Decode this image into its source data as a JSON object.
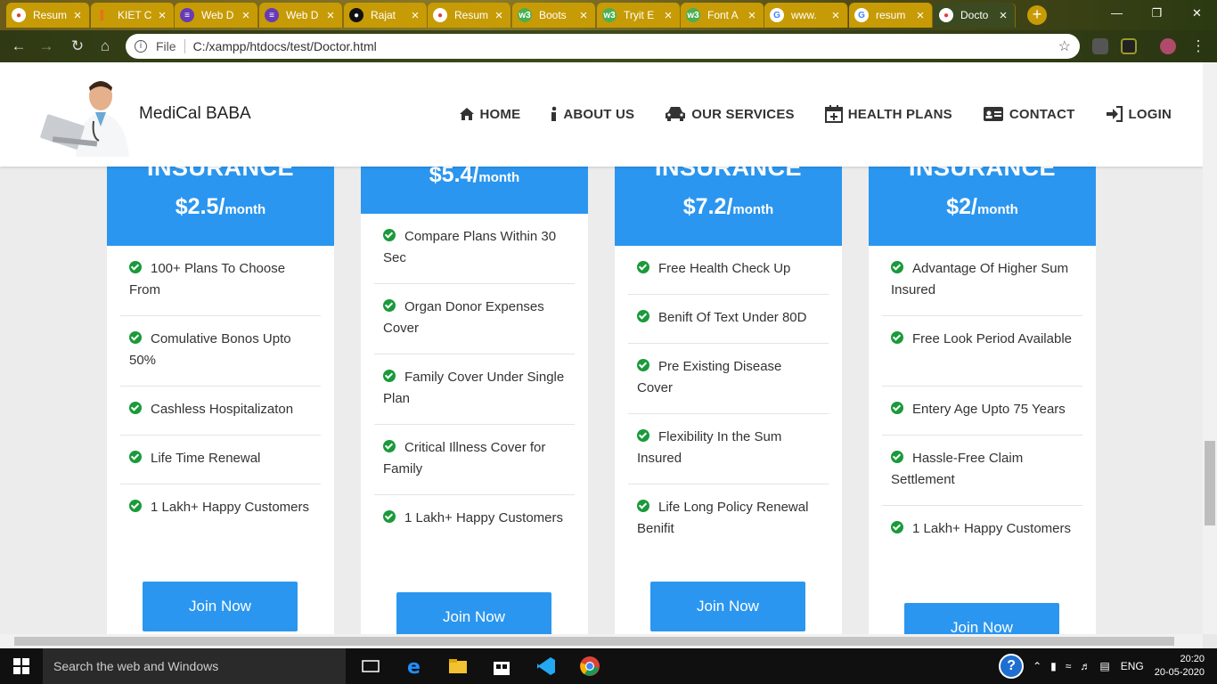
{
  "browser": {
    "tabs": [
      {
        "label": "Resum",
        "icon": "chrome-icon"
      },
      {
        "label": "KIET C",
        "icon": "chart-icon"
      },
      {
        "label": "Web D",
        "icon": "form-icon"
      },
      {
        "label": "Web D",
        "icon": "form-icon"
      },
      {
        "label": "Rajat",
        "icon": "github-icon"
      },
      {
        "label": "Resum",
        "icon": "chrome-icon"
      },
      {
        "label": "Boots",
        "icon": "w3-icon"
      },
      {
        "label": "Tryit E",
        "icon": "w3-icon"
      },
      {
        "label": "Font A",
        "icon": "w3-icon"
      },
      {
        "label": "www.",
        "icon": "google-icon"
      },
      {
        "label": "resum",
        "icon": "google-icon"
      },
      {
        "label": "Docto",
        "icon": "chrome-icon"
      }
    ],
    "address": {
      "scheme_label": "File",
      "url": "C:/xampp/htdocs/test/Doctor.html"
    }
  },
  "site": {
    "brand": "MediCal BABA",
    "nav": [
      {
        "label": "HOME",
        "icon": "home-icon"
      },
      {
        "label": "ABOUT US",
        "icon": "info-icon"
      },
      {
        "label": "OUR SERVICES",
        "icon": "car-icon"
      },
      {
        "label": "HEALTH PLANS",
        "icon": "calendar-plus-icon"
      },
      {
        "label": "CONTACT",
        "icon": "id-card-icon"
      },
      {
        "label": "LOGIN",
        "icon": "sign-in-icon"
      }
    ],
    "plans": [
      {
        "title": "INSURANCE",
        "price": "$2.5/",
        "unit": "month",
        "features": [
          "100+ Plans To Choose From",
          "Comulative Bonos Upto 50%",
          "Cashless Hospitalizaton",
          "Life Time Renewal",
          "1 Lakh+ Happy Customers"
        ],
        "button": "Join Now"
      },
      {
        "title": "",
        "price": "$5.4/",
        "unit": "month",
        "features": [
          "Compare Plans Within 30 Sec",
          "Organ Donor Expenses Cover",
          "Family Cover Under Single Plan",
          "Critical Illness Cover for Family",
          "1 Lakh+ Happy Customers"
        ],
        "button": "Join Now"
      },
      {
        "title": "INSURANCE",
        "price": "$7.2/",
        "unit": "month",
        "features": [
          "Free Health Check Up",
          "Benift Of Text Under 80D",
          "Pre Existing Disease Cover",
          "Flexibility In the Sum Insured",
          "Life Long Policy Renewal Benifit"
        ],
        "button": "Join Now"
      },
      {
        "title": "INSURANCE",
        "price": "$2/",
        "unit": "month",
        "features": [
          "Advantage Of Higher Sum Insured",
          "Free Look Period Available",
          "Entery Age Upto 75 Years",
          "Hassle-Free Claim Settlement",
          "1 Lakh+ Happy Customers"
        ],
        "button": "Join Now"
      }
    ]
  },
  "taskbar": {
    "search_placeholder": "Search the web and Windows",
    "language": "ENG",
    "time": "20:20",
    "date": "20-05-2020"
  },
  "colors": {
    "accent": "#2b96ef",
    "check": "#1a9a3a",
    "tab": "#c79b05"
  }
}
